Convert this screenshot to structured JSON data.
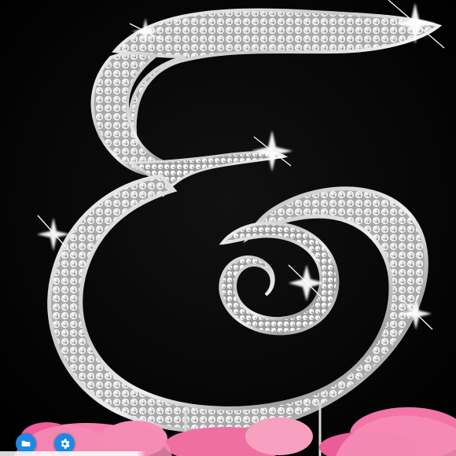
{
  "image": {
    "subject": "rhinestone-letter-e-cake-topper",
    "background_color": "#030303",
    "letter_color": "#d8d8d8",
    "flower_color": "#f07aa6"
  },
  "controls": {
    "folder_icon": "folder-icon",
    "settings_icon": "gear-icon",
    "accent_color": "#1e88e5"
  }
}
